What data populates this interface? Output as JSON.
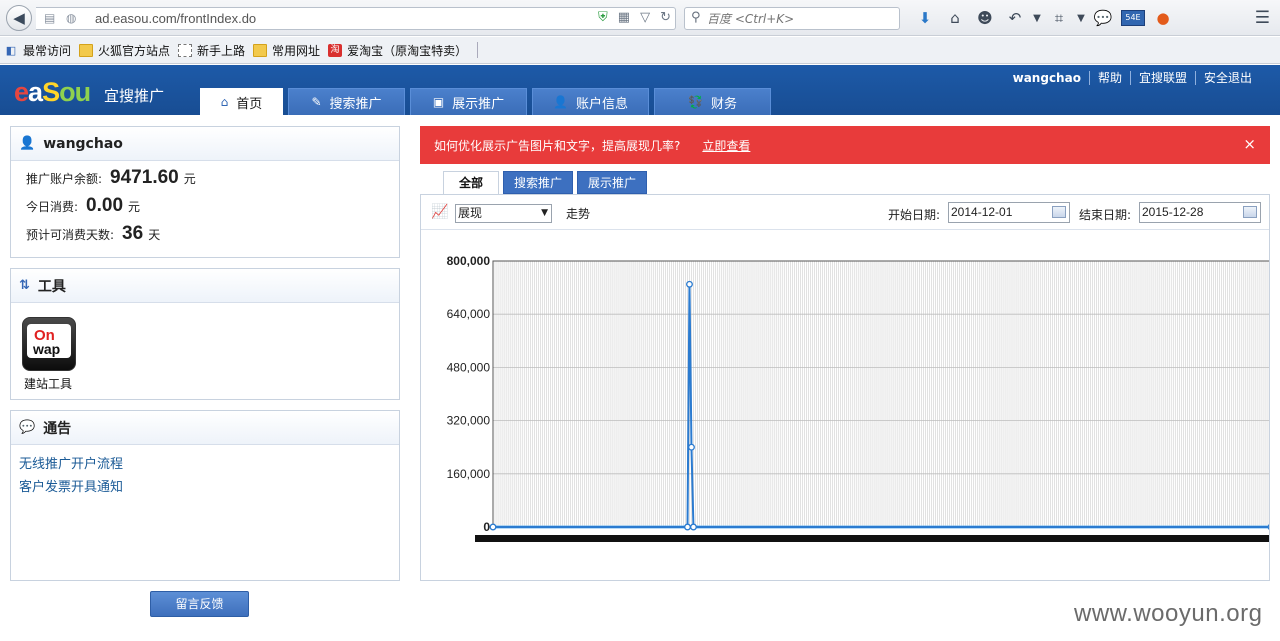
{
  "browser": {
    "url": "ad.easou.com/frontIndex.do",
    "search_placeholder": "百度 <Ctrl+K>",
    "bookmarks": [
      {
        "label": "最常访问",
        "icon": "bookmarks-icon"
      },
      {
        "label": "火狐官方站点",
        "icon": "folder-icon"
      },
      {
        "label": "新手上路",
        "icon": "page-icon"
      },
      {
        "label": "常用网址",
        "icon": "folder-icon"
      },
      {
        "label": "爱淘宝（原淘宝特卖）",
        "icon": "taobao-icon"
      }
    ],
    "taobao_glyph": "淘",
    "badge_text": "54E"
  },
  "header": {
    "logo_parts": [
      "e",
      "a",
      "S",
      "ou"
    ],
    "logo_sub": "宜搜推广",
    "tabs": [
      {
        "label": "首页",
        "icon": "home-icon",
        "active": true
      },
      {
        "label": "搜索推广",
        "icon": "edit-icon",
        "active": false
      },
      {
        "label": "展示推广",
        "icon": "image-icon",
        "active": false
      },
      {
        "label": "账户信息",
        "icon": "user-icon",
        "active": false
      },
      {
        "label": "财务",
        "icon": "money-icon",
        "active": false
      }
    ],
    "top_links": [
      "wangchao",
      "帮助",
      "宜搜联盟",
      "安全退出"
    ]
  },
  "account": {
    "username": "wangchao",
    "rows": [
      {
        "label": "推广账户余额:",
        "value": "9471.60",
        "unit": "元"
      },
      {
        "label": "今日消费:",
        "value": "0.00",
        "unit": "元"
      },
      {
        "label": "预计可消费天数:",
        "value": "36",
        "unit": "天"
      }
    ]
  },
  "tools": {
    "title": "工具",
    "icon_text_1": "On",
    "icon_text_2": "wap",
    "tool_label": "建站工具"
  },
  "notice": {
    "title": "通告",
    "links": [
      "无线推广开户流程",
      "客户发票开具通知"
    ]
  },
  "feedback_label": "留言反馈",
  "alert": {
    "text": "如何优化展示广告图片和文字，提高展现几率?",
    "link": "立即查看",
    "close": "×"
  },
  "sub_tabs": [
    {
      "label": "全部",
      "active": true
    },
    {
      "label": "搜索推广",
      "active": false
    },
    {
      "label": "展示推广",
      "active": false
    }
  ],
  "chart_controls": {
    "metric": "展现",
    "trend_label": "走势",
    "start_label": "开始日期:",
    "start_date": "2014-12-01",
    "end_label": "结束日期:",
    "end_date": "2015-12-28"
  },
  "chart_data": {
    "type": "line",
    "ylim": [
      0,
      800000
    ],
    "yticks": [
      "0",
      "160,000",
      "320,000",
      "480,000",
      "640,000",
      "800,000"
    ],
    "n_points": 393,
    "series": [
      {
        "values_sparse": [
          {
            "index": 98,
            "value": 0
          },
          {
            "index": 99,
            "value": 730000
          },
          {
            "index": 100,
            "value": 240000
          },
          {
            "index": 101,
            "value": 0
          }
        ],
        "baseline": 0
      }
    ],
    "grid": true,
    "color": "#2b7bd0"
  },
  "watermark": "www.wooyun.org"
}
